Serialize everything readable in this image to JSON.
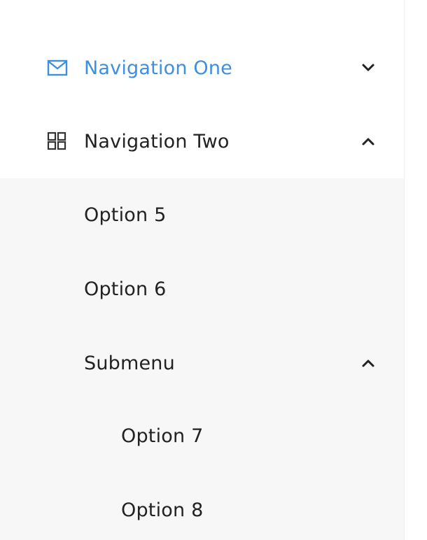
{
  "menu": {
    "navigation_one": {
      "label": "Navigation One",
      "icon": "mail-icon",
      "expanded": false,
      "color": "#3d8fe0"
    },
    "navigation_two": {
      "label": "Navigation Two",
      "icon": "appstore-icon",
      "expanded": true
    },
    "items": {
      "option_5": "Option 5",
      "option_6": "Option 6",
      "submenu": {
        "label": "Submenu",
        "expanded": true
      },
      "option_7": "Option 7",
      "option_8": "Option 8"
    }
  }
}
